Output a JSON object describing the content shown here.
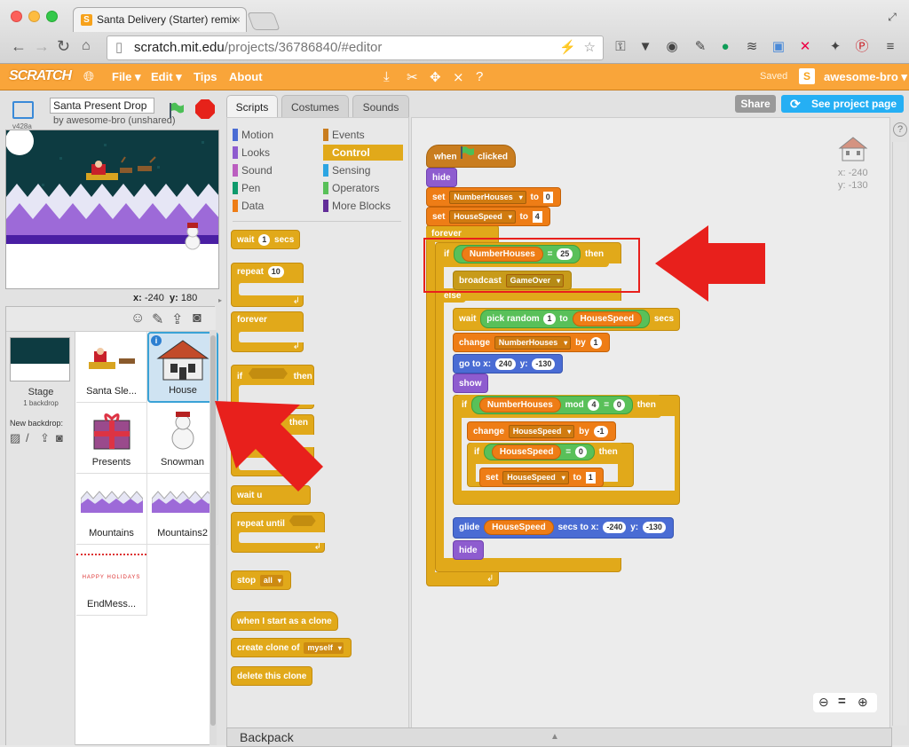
{
  "browser": {
    "tab_title": "Santa Delivery (Starter) remix",
    "url_host": "scratch.mit.edu",
    "url_path": "/projects/36786840/#editor"
  },
  "menubar": {
    "logo": "SCRATCH",
    "items": [
      "File ▾",
      "Edit ▾",
      "Tips",
      "About"
    ],
    "saved": "Saved",
    "user": "awesome-bro ▾",
    "share": "Share",
    "see_project": "See project page"
  },
  "stage": {
    "project_title": "Santa Present Drop",
    "byline": "by awesome-bro (unshared)",
    "version": "v428a",
    "x_label": "x:",
    "x_value": "-240",
    "y_label": "y:",
    "y_value": "180"
  },
  "sprites": {
    "stage_label": "Stage",
    "stage_sub": "1 backdrop",
    "new_backdrop": "New backdrop:",
    "items": [
      {
        "name": "Santa Sle..."
      },
      {
        "name": "House"
      },
      {
        "name": "Presents"
      },
      {
        "name": "Snowman"
      },
      {
        "name": "Mountains"
      },
      {
        "name": "Mountains2"
      },
      {
        "name": "EndMess..."
      }
    ],
    "end_message_text": "HAPPY HOLIDAYS"
  },
  "editor_tabs": [
    "Scripts",
    "Costumes",
    "Sounds"
  ],
  "categories": {
    "left": [
      "Motion",
      "Looks",
      "Sound",
      "Pen",
      "Data"
    ],
    "right": [
      "Events",
      "Control",
      "Sensing",
      "Operators",
      "More Blocks"
    ],
    "colors_left": [
      "#4a6cd4",
      "#8e5ccf",
      "#bb5ec0",
      "#0e9a6c",
      "#ee7d16"
    ],
    "colors_right": [
      "#c97d1f",
      "#e1a91a",
      "#2ca5e2",
      "#59c059",
      "#632d99"
    ],
    "active": "Control"
  },
  "palette": {
    "wait": "wait",
    "wait_val": "1",
    "secs": "secs",
    "repeat": "repeat",
    "repeat_val": "10",
    "forever": "forever",
    "if": "if",
    "then": "then",
    "then2": "then",
    "wait_until": "wait u",
    "repeat_until": "repeat until",
    "stop": "stop",
    "stop_val": "all",
    "start_clone": "when I start as a clone",
    "create_clone": "create clone of",
    "create_clone_val": "myself",
    "delete_clone": "delete this clone"
  },
  "script": {
    "when_flag": "when",
    "clicked": "clicked",
    "hide": "hide",
    "set": "set",
    "to": "to",
    "var_numhouses": "NumberHouses",
    "var_speed": "HouseSpeed",
    "zero": "0",
    "four": "4",
    "forever": "forever",
    "if": "if",
    "eq": "=",
    "twentyfive": "25",
    "then": "then",
    "broadcast": "broadcast",
    "gameover": "GameOver",
    "else": "else",
    "wait": "wait",
    "pick_random": "pick random",
    "one": "1",
    "secs": "secs",
    "change": "change",
    "by": "by",
    "go_to": "go to x:",
    "x240": "240",
    "y_lbl": "y:",
    "y130": "-130",
    "show": "show",
    "mod": "mod",
    "neg1": "-1",
    "glide": "glide",
    "secs_to_x": "secs to x:",
    "xneg240": "-240",
    "sprite_x": "x: -240",
    "sprite_y": "y: -130"
  },
  "backpack": "Backpack",
  "annotation_color": "#e8201c"
}
